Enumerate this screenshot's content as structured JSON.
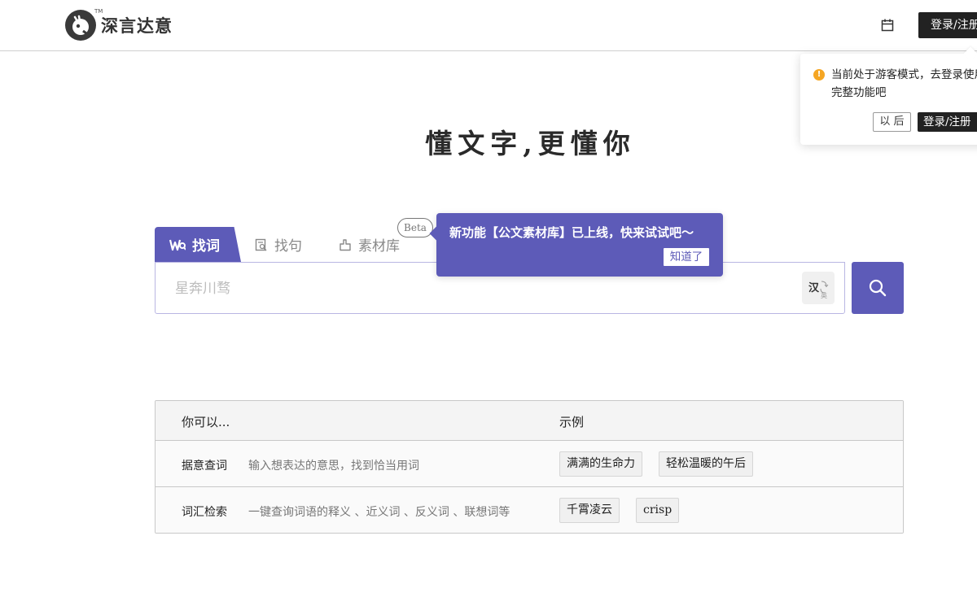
{
  "header": {
    "logo_text": "深言达意",
    "logo_tm": "TM",
    "calendar_icon": "calendar-icon",
    "login_label": "登录/注册"
  },
  "guest_popover": {
    "message": "当前处于游客模式，去登录使用完整功能吧",
    "later_label": "以 后",
    "login_label": "登录/注册",
    "icon": "warning-icon",
    "icon_color": "#f5a623"
  },
  "slogan": "懂文字,更懂你",
  "tabs": [
    {
      "label": "找词",
      "icon": "word-icon",
      "active": true
    },
    {
      "label": "找句",
      "icon": "sentence-icon",
      "active": false
    },
    {
      "label": "素材库",
      "icon": "material-icon",
      "active": false
    }
  ],
  "beta_badge": "Beta",
  "search": {
    "placeholder": "星奔川骛",
    "lang_primary": "汉",
    "lang_secondary": "英",
    "button_icon": "search-icon"
  },
  "feature_tip": {
    "text": "新功能【公文素材库】已上线，快来试试吧～",
    "button_label": "知道了"
  },
  "examples": {
    "col_a": "你可以...",
    "col_b": "示例",
    "rows": [
      {
        "title": "据意查词",
        "desc": "输入想表达的意思，找到恰当用词",
        "chips": [
          "满满的生命力",
          "轻松温暖的午后"
        ]
      },
      {
        "title": "词汇检索",
        "desc": "一键查询词语的释义 、近义词 、反义词 、联想词等",
        "chips": [
          "千霄凌云",
          "crisp"
        ]
      }
    ]
  },
  "colors": {
    "accent": "#5d5bb8",
    "dark_button": "#222222",
    "warning": "#f5a623"
  }
}
